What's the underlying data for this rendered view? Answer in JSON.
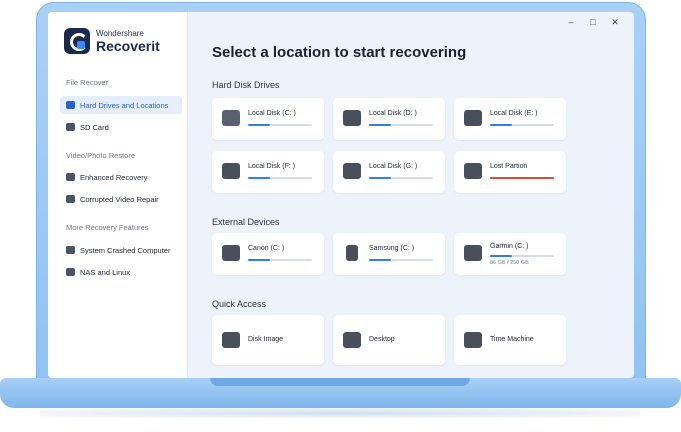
{
  "app": {
    "brand": "Wondershare",
    "name": "Recoverit"
  },
  "window_controls": {
    "minimize": "–",
    "maximize": "□",
    "close": "✕"
  },
  "sidebar": {
    "sections": [
      {
        "label": "File Recover"
      },
      {
        "label": "Video/Photo Restore"
      },
      {
        "label": "More Recovery Features"
      }
    ],
    "items": [
      {
        "label": "Hard Drives and Locations",
        "icon": "hard-drive-icon",
        "active": true
      },
      {
        "label": "SD Card",
        "icon": "sd-card-icon"
      },
      {
        "label": "Enhanced Recovery",
        "icon": "camera-icon"
      },
      {
        "label": "Corrupted Video Repair",
        "icon": "video-repair-icon"
      },
      {
        "label": "System Crashed Computer",
        "icon": "computer-icon"
      },
      {
        "label": "NAS and Linux",
        "icon": "nas-icon"
      }
    ]
  },
  "main": {
    "title": "Select a location to start recovering",
    "sections": {
      "hard_disk": "Hard Disk Drives",
      "external": "External Devices",
      "quick_access": "Quick Access"
    },
    "hard_drives": [
      {
        "label": "Local Disk (C: )",
        "icon": "windows-drive-icon",
        "fill": 0.35,
        "color": "#2f80ed"
      },
      {
        "label": "Local Disk (D: )",
        "icon": "hard-disk-icon",
        "fill": 0.35,
        "color": "#2f80ed"
      },
      {
        "label": "Local Disk (E: )",
        "icon": "hard-disk-icon",
        "fill": 0.35,
        "color": "#2f80ed"
      },
      {
        "label": "Local Disk (F: )",
        "icon": "hard-disk-icon",
        "fill": 0.35,
        "color": "#2f80ed"
      },
      {
        "label": "Local Disk (G: )",
        "icon": "usb-drive-icon",
        "fill": 0.35,
        "color": "#2f80ed"
      },
      {
        "label": "Lost Partion",
        "icon": "lost-partition-icon",
        "fill": 1.0,
        "color": "#e04b3a"
      }
    ],
    "external_devices": [
      {
        "label": "Canon (C: )",
        "icon": "camera-icon",
        "fill": 0.35,
        "color": "#2f80ed",
        "sub": ""
      },
      {
        "label": "Samsung (C: )",
        "icon": "phone-icon",
        "fill": 0.35,
        "color": "#2f80ed",
        "sub": ""
      },
      {
        "label": "Garmin (C: )",
        "icon": "dashcam-icon",
        "fill": 0.34,
        "color": "#2f80ed",
        "sub": "86 GB / 250 GB"
      }
    ],
    "quick_access": [
      {
        "label": "Disk Image",
        "icon": "disk-image-icon"
      },
      {
        "label": "Desktop",
        "icon": "desktop-icon"
      },
      {
        "label": "Time Machine",
        "icon": "time-machine-icon"
      }
    ]
  }
}
